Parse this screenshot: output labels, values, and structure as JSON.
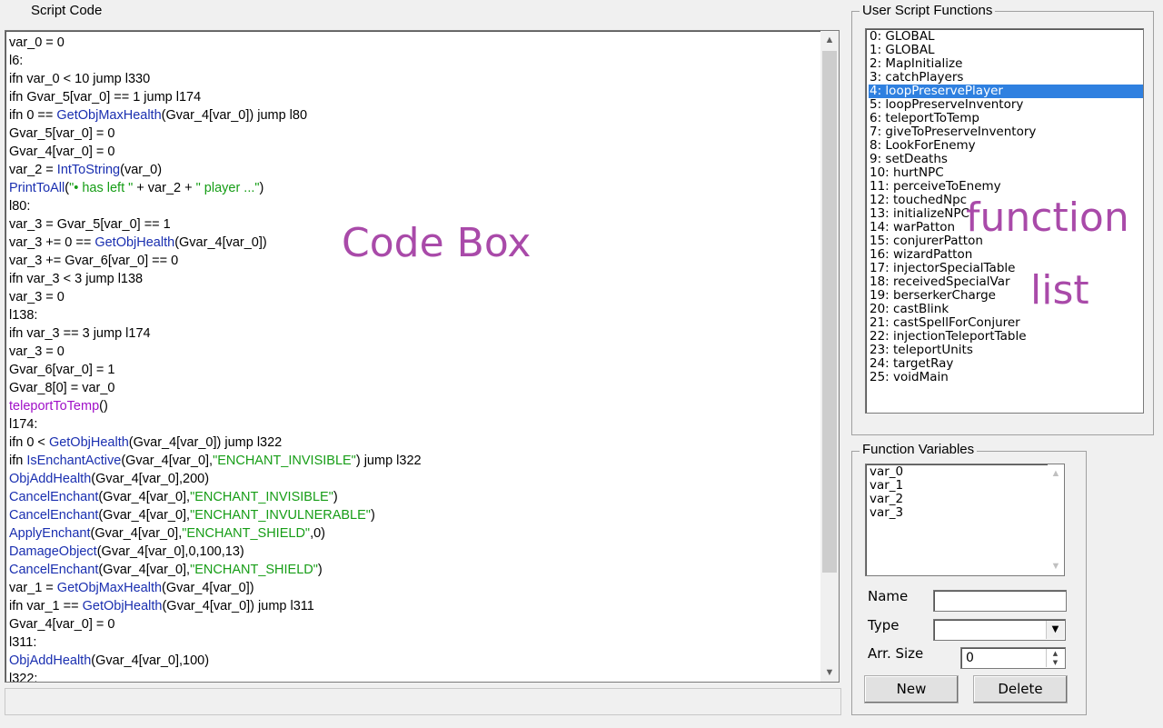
{
  "script_code": {
    "title": "Script Code",
    "watermark": "Code Box",
    "lines": [
      [
        [
          "p",
          "var_0 = 0"
        ]
      ],
      [
        [
          "p",
          "l6:"
        ]
      ],
      [
        [
          "p",
          "ifn var_0 < 10 jump l330"
        ]
      ],
      [
        [
          "p",
          "ifn Gvar_5[var_0] == 1 jump l174"
        ]
      ],
      [
        [
          "p",
          "ifn 0 == "
        ],
        [
          "f",
          "GetObjMaxHealth"
        ],
        [
          "p",
          "(Gvar_4[var_0]) jump l80"
        ]
      ],
      [
        [
          "p",
          "Gvar_5[var_0] = 0"
        ]
      ],
      [
        [
          "p",
          "Gvar_4[var_0] = 0"
        ]
      ],
      [
        [
          "p",
          "var_2 = "
        ],
        [
          "f",
          "IntToString"
        ],
        [
          "p",
          "(var_0)"
        ]
      ],
      [
        [
          "f",
          "PrintToAll"
        ],
        [
          "p",
          "("
        ],
        [
          "s",
          "\"• has left \""
        ],
        [
          "p",
          " + var_2 + "
        ],
        [
          "s",
          "\" player ...\""
        ],
        [
          "p",
          ")"
        ]
      ],
      [
        [
          "p",
          "l80:"
        ]
      ],
      [
        [
          "p",
          "var_3 = Gvar_5[var_0] == 1"
        ]
      ],
      [
        [
          "p",
          "var_3 += 0 == "
        ],
        [
          "f",
          "GetObjHealth"
        ],
        [
          "p",
          "(Gvar_4[var_0])"
        ]
      ],
      [
        [
          "p",
          "var_3 += Gvar_6[var_0] == 0"
        ]
      ],
      [
        [
          "p",
          "ifn var_3 < 3 jump l138"
        ]
      ],
      [
        [
          "p",
          "var_3 = 0"
        ]
      ],
      [
        [
          "p",
          "l138:"
        ]
      ],
      [
        [
          "p",
          "ifn var_3 == 3 jump l174"
        ]
      ],
      [
        [
          "p",
          "var_3 = 0"
        ]
      ],
      [
        [
          "p",
          "Gvar_6[var_0] = 1"
        ]
      ],
      [
        [
          "p",
          "Gvar_8[0] = var_0"
        ]
      ],
      [
        [
          "u",
          "teleportToTemp"
        ],
        [
          "p",
          "()"
        ]
      ],
      [
        [
          "p",
          "l174:"
        ]
      ],
      [
        [
          "p",
          "ifn 0 < "
        ],
        [
          "f",
          "GetObjHealth"
        ],
        [
          "p",
          "(Gvar_4[var_0]) jump l322"
        ]
      ],
      [
        [
          "p",
          "ifn "
        ],
        [
          "f",
          "IsEnchantActive"
        ],
        [
          "p",
          "(Gvar_4[var_0],"
        ],
        [
          "s",
          "\"ENCHANT_INVISIBLE\""
        ],
        [
          "p",
          ") jump l322"
        ]
      ],
      [
        [
          "f",
          "ObjAddHealth"
        ],
        [
          "p",
          "(Gvar_4[var_0],200)"
        ]
      ],
      [
        [
          "f",
          "CancelEnchant"
        ],
        [
          "p",
          "(Gvar_4[var_0],"
        ],
        [
          "s",
          "\"ENCHANT_INVISIBLE\""
        ],
        [
          "p",
          ")"
        ]
      ],
      [
        [
          "f",
          "CancelEnchant"
        ],
        [
          "p",
          "(Gvar_4[var_0],"
        ],
        [
          "s",
          "\"ENCHANT_INVULNERABLE\""
        ],
        [
          "p",
          ")"
        ]
      ],
      [
        [
          "f",
          "ApplyEnchant"
        ],
        [
          "p",
          "(Gvar_4[var_0],"
        ],
        [
          "s",
          "\"ENCHANT_SHIELD\""
        ],
        [
          "p",
          ",0)"
        ]
      ],
      [
        [
          "f",
          "DamageObject"
        ],
        [
          "p",
          "(Gvar_4[var_0],0,100,13)"
        ]
      ],
      [
        [
          "f",
          "CancelEnchant"
        ],
        [
          "p",
          "(Gvar_4[var_0],"
        ],
        [
          "s",
          "\"ENCHANT_SHIELD\""
        ],
        [
          "p",
          ")"
        ]
      ],
      [
        [
          "p",
          "var_1 = "
        ],
        [
          "f",
          "GetObjMaxHealth"
        ],
        [
          "p",
          "(Gvar_4[var_0])"
        ]
      ],
      [
        [
          "p",
          "ifn var_1 == "
        ],
        [
          "f",
          "GetObjHealth"
        ],
        [
          "p",
          "(Gvar_4[var_0]) jump l311"
        ]
      ],
      [
        [
          "p",
          "Gvar_4[var_0] = 0"
        ]
      ],
      [
        [
          "p",
          "l311:"
        ]
      ],
      [
        [
          "f",
          "ObjAddHealth"
        ],
        [
          "p",
          "(Gvar_4[var_0],100)"
        ]
      ],
      [
        [
          "p",
          "l322:"
        ]
      ]
    ],
    "scroll_up": "▲",
    "scroll_down": "▼"
  },
  "user_functions": {
    "title": "User Script Functions",
    "selected_index": 4,
    "items": [
      "0: GLOBAL",
      "1: GLOBAL",
      "2: MapInitialize",
      "3: catchPlayers",
      "4: loopPreservePlayer",
      "5: loopPreserveInventory",
      "6: teleportToTemp",
      "7: giveToPreserveInventory",
      "8: LookForEnemy",
      "9: setDeaths",
      "10: hurtNPC",
      "11: perceiveToEnemy",
      "12: touchedNpc",
      "13: initializeNPC",
      "14: warPatton",
      "15: conjurerPatton",
      "16: wizardPatton",
      "17: injectorSpecialTable",
      "18: receivedSpecialVar",
      "19: berserkerCharge",
      "20: castBlink",
      "21: castSpellForConjurer",
      "22: injectionTeleportTable",
      "23: teleportUnits",
      "24: targetRay",
      "25: voidMain"
    ],
    "watermark_1": "function",
    "watermark_2": "list"
  },
  "function_variables": {
    "title": "Function Variables",
    "items": [
      "var_0",
      "var_1",
      "var_2",
      "var_3"
    ],
    "name_label": "Name",
    "name_value": "",
    "type_label": "Type",
    "type_value": "",
    "arr_size_label": "Arr. Size",
    "arr_size_value": "0",
    "new_button": "New",
    "delete_button": "Delete"
  },
  "colors": {
    "function_call": "#1a2fb0",
    "user_function_call": "#a010c8",
    "string_literal": "#169d16",
    "selection": "#2f80e0",
    "watermark": "#a94aa9"
  }
}
